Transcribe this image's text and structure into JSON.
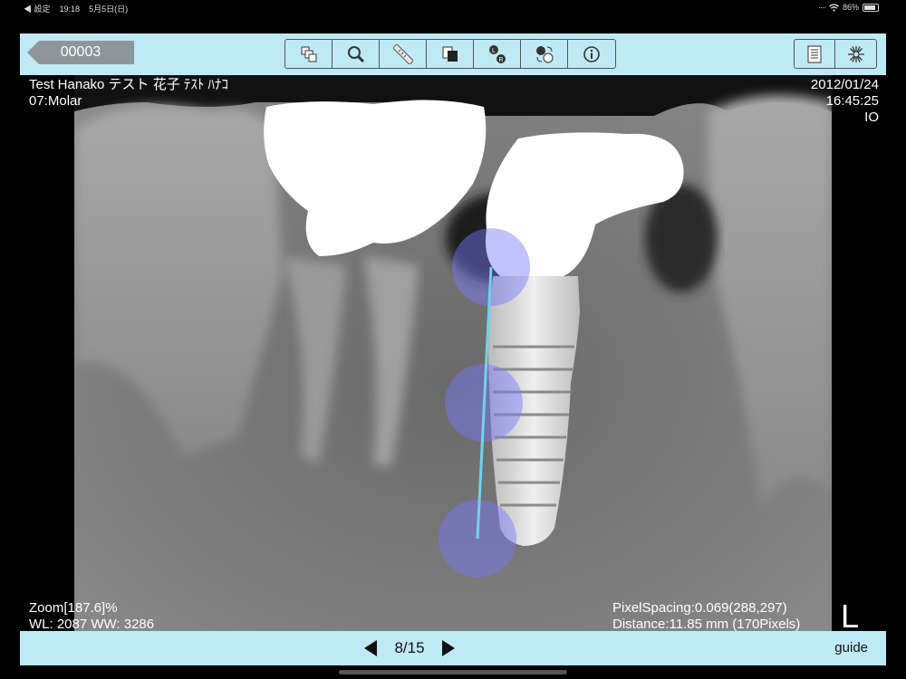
{
  "status_bar": {
    "back_app": "◀ 設定",
    "time": "19:18",
    "date": "5月5日(日)",
    "battery": "86%",
    "battery_level": 0.86
  },
  "toolbar": {
    "back_label": "00003",
    "tools": [
      {
        "name": "layout-tool",
        "icon": "multi-window-icon"
      },
      {
        "name": "zoom-tool",
        "icon": "magnifier-icon"
      },
      {
        "name": "measure-tool",
        "icon": "ruler-icon"
      },
      {
        "name": "window-level-tool",
        "icon": "contrast-icon"
      },
      {
        "name": "flip-tool",
        "icon": "left-right-flip-icon"
      },
      {
        "name": "rotate-tool",
        "icon": "rotate-icon"
      },
      {
        "name": "info-tool",
        "icon": "info-icon"
      }
    ],
    "right_tools": [
      {
        "name": "report-button",
        "icon": "list-document-icon"
      },
      {
        "name": "settings-button",
        "icon": "dial-icon"
      }
    ]
  },
  "overlay": {
    "patient_name": "Test Hanako テスト 花子 ﾃｽﾄ ﾊﾅｺ",
    "tooth": "07:Molar",
    "date": "2012/01/24",
    "time": "16:45:25",
    "modality": "IO",
    "zoom": "Zoom[187.6]%",
    "wl_ww": "WL: 2087 WW: 3286",
    "pixel_spacing": "PixelSpacing:0.069(288,297)",
    "distance": "Distance:11.85 mm (170Pixels)",
    "side_marker": "L"
  },
  "bottom_bar": {
    "page": "8/15",
    "guide_label": "guide"
  },
  "colors": {
    "toolbar_bg": "#bfe9f5",
    "measure_line": "#6fd3ea",
    "handle": "#8c8cff"
  }
}
